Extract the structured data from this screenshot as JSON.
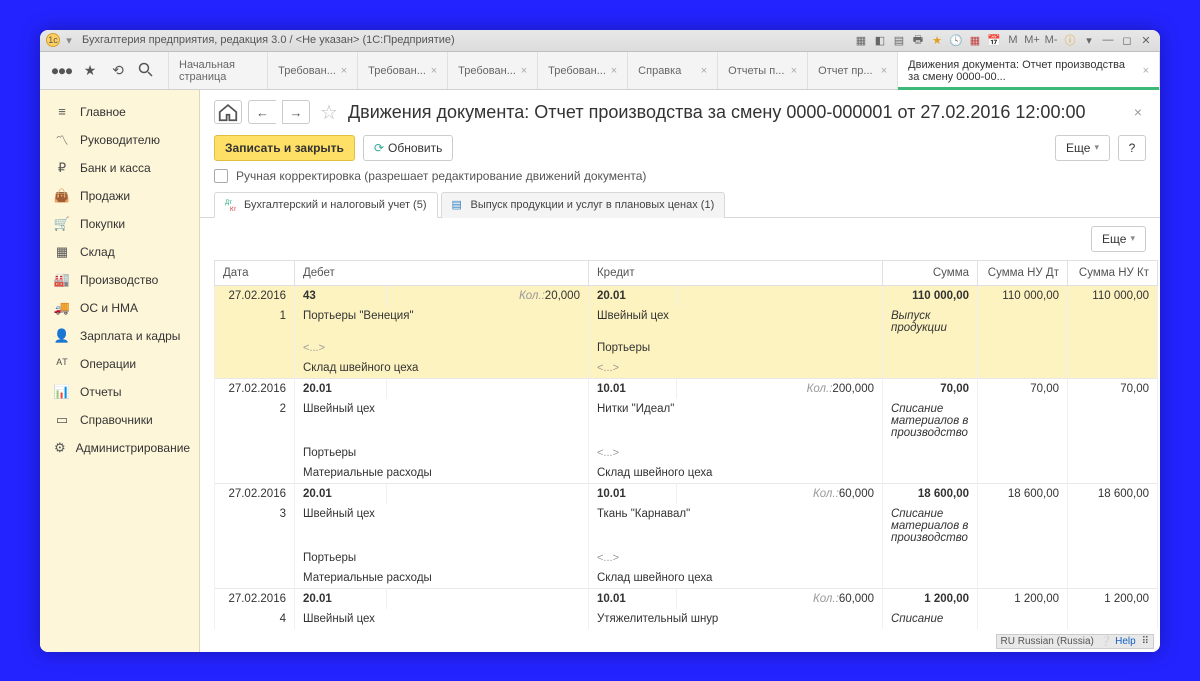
{
  "titlebar": {
    "title": "Бухгалтерия предприятия, редакция 3.0 / <Не указан>   (1С:Предприятие)",
    "m_buttons": [
      "M",
      "M+",
      "M-"
    ]
  },
  "topnav_tabs": [
    {
      "label": "Начальная страница",
      "closable": false
    },
    {
      "label": "Требован...",
      "closable": true
    },
    {
      "label": "Требован...",
      "closable": true
    },
    {
      "label": "Требован...",
      "closable": true
    },
    {
      "label": "Требован...",
      "closable": true
    },
    {
      "label": "Справка",
      "closable": true
    },
    {
      "label": "Отчеты п...",
      "closable": true
    },
    {
      "label": "Отчет пр...",
      "closable": true
    },
    {
      "label": "Движения документа: Отчет производства за смену 0000-00...",
      "closable": true,
      "active": true
    }
  ],
  "sidebar": [
    {
      "icon": "menu",
      "label": "Главное"
    },
    {
      "icon": "chart",
      "label": "Руководителю"
    },
    {
      "icon": "ruble",
      "label": "Банк и касса"
    },
    {
      "icon": "bag",
      "label": "Продажи"
    },
    {
      "icon": "cart",
      "label": "Покупки"
    },
    {
      "icon": "boxes",
      "label": "Склад"
    },
    {
      "icon": "factory",
      "label": "Производство"
    },
    {
      "icon": "truck",
      "label": "ОС и НМА"
    },
    {
      "icon": "person",
      "label": "Зарплата и кадры"
    },
    {
      "icon": "ops",
      "label": "Операции"
    },
    {
      "icon": "bars",
      "label": "Отчеты"
    },
    {
      "icon": "book",
      "label": "Справочники"
    },
    {
      "icon": "gear",
      "label": "Администрирование"
    }
  ],
  "main": {
    "title": "Движения документа: Отчет производства за смену 0000-000001 от 27.02.2016 12:00:00",
    "save_close": "Записать и закрыть",
    "refresh": "Обновить",
    "more": "Еще",
    "help": "?",
    "manual_check_label": "Ручная корректировка (разрешает редактирование движений документа)",
    "subtab1": "Бухгалтерский и налоговый учет (5)",
    "subtab2": "Выпуск продукции и услуг в плановых ценах (1)"
  },
  "table": {
    "headers": {
      "date": "Дата",
      "debit": "Дебет",
      "credit": "Кредит",
      "sum": "Сумма",
      "nu_dt": "Сумма НУ Дт",
      "nu_kt": "Сумма НУ Кт"
    },
    "kol_label": "Кол.:",
    "rows": [
      {
        "selected": true,
        "date": "27.02.2016",
        "n": "1",
        "deb_acct": "43",
        "deb_qty": "20,000",
        "cred_acct": "20.01",
        "sum": "110 000,00",
        "nu_dt": "110 000,00",
        "nu_kt": "110 000,00",
        "deb_sub": [
          "Портьеры \"Венеция\"",
          "<...>",
          "Склад швейного цеха"
        ],
        "cred_sub": [
          "Швейный цех",
          "Портьеры",
          "<...>"
        ],
        "op": "Выпуск продукции"
      },
      {
        "date": "27.02.2016",
        "n": "2",
        "deb_acct": "20.01",
        "cred_acct": "10.01",
        "cred_qty": "200,000",
        "sum": "70,00",
        "nu_dt": "70,00",
        "nu_kt": "70,00",
        "deb_sub": [
          "Швейный цех",
          "Портьеры",
          "Материальные расходы"
        ],
        "cred_sub": [
          "Нитки \"Идеал\"",
          "<...>",
          "Склад швейного цеха"
        ],
        "op": "Списание материалов в производство"
      },
      {
        "date": "27.02.2016",
        "n": "3",
        "deb_acct": "20.01",
        "cred_acct": "10.01",
        "cred_qty": "60,000",
        "sum": "18 600,00",
        "nu_dt": "18 600,00",
        "nu_kt": "18 600,00",
        "deb_sub": [
          "Швейный цех",
          "Портьеры",
          "Материальные расходы"
        ],
        "cred_sub": [
          "Ткань \"Карнавал\"",
          "<...>",
          "Склад швейного цеха"
        ],
        "op": "Списание материалов в производство"
      },
      {
        "date": "27.02.2016",
        "n": "4",
        "deb_acct": "20.01",
        "cred_acct": "10.01",
        "cred_qty": "60,000",
        "sum": "1 200,00",
        "nu_dt": "1 200,00",
        "nu_kt": "1 200,00",
        "deb_sub": [
          "Швейный цех"
        ],
        "cred_sub": [
          "Утяжелительный шнур"
        ],
        "op": "Списание"
      }
    ]
  },
  "status": {
    "lang": "RU Russian (Russia)",
    "help": "Help"
  }
}
